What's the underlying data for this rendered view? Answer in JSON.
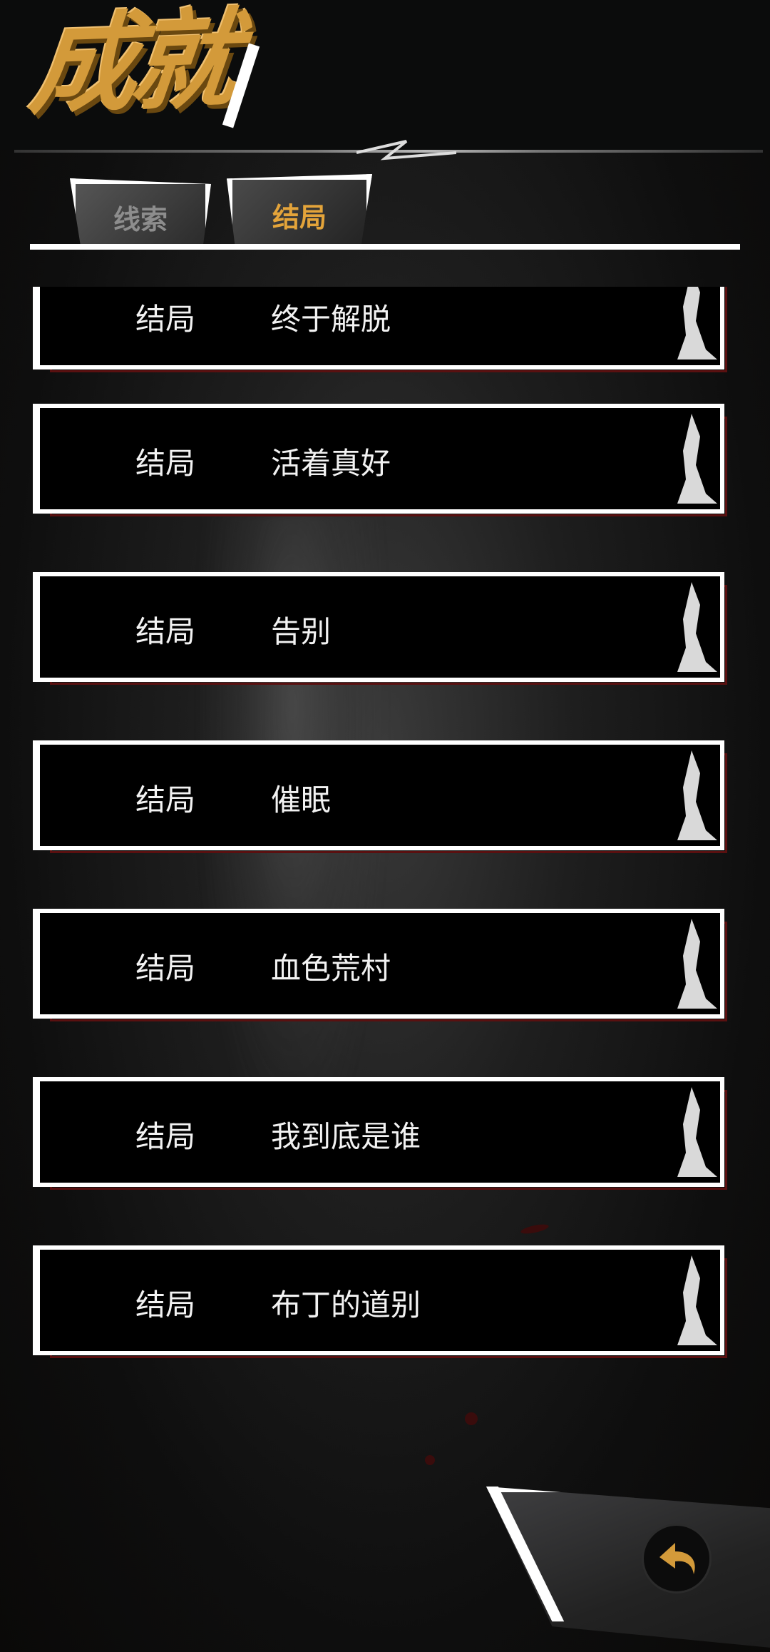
{
  "header": {
    "title": "成就"
  },
  "tabs": [
    {
      "label": "线索",
      "active": false
    },
    {
      "label": "结局",
      "active": true
    }
  ],
  "entries": [
    {
      "label": "结局",
      "name": "终于解脱"
    },
    {
      "label": "结局",
      "name": "活着真好"
    },
    {
      "label": "结局",
      "name": "告别"
    },
    {
      "label": "结局",
      "name": "催眠"
    },
    {
      "label": "结局",
      "name": "血色荒村"
    },
    {
      "label": "结局",
      "name": "我到底是谁"
    },
    {
      "label": "结局",
      "name": "布丁的道别"
    }
  ],
  "colors": {
    "accent": "#d39a3a",
    "inactive_tab_text": "#8d8d8d",
    "row_shadow": "#5a1010"
  },
  "icons": {
    "back": "back-arrow-icon"
  }
}
